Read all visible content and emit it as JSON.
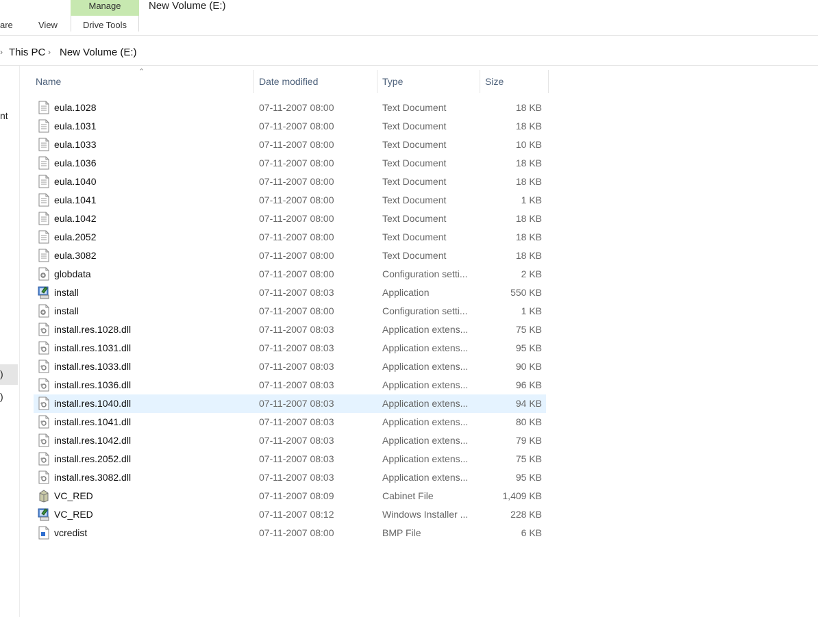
{
  "ribbon": {
    "tab_share_fragment": "are",
    "tab_view": "View",
    "context_group": "Manage",
    "context_tab": "Drive Tools",
    "window_title": "New Volume (E:)"
  },
  "address": {
    "crumbs": [
      "This PC",
      "New Volume (E:)"
    ]
  },
  "nav": {
    "fragments": [
      "nt",
      ")",
      ")"
    ]
  },
  "columns": {
    "name": "Name",
    "date": "Date modified",
    "type": "Type",
    "size": "Size"
  },
  "files": [
    {
      "name": "eula.1028",
      "date": "07-11-2007 08:00",
      "type": "Text Document",
      "size": "18 KB",
      "icon": "text-document-icon"
    },
    {
      "name": "eula.1031",
      "date": "07-11-2007 08:00",
      "type": "Text Document",
      "size": "18 KB",
      "icon": "text-document-icon"
    },
    {
      "name": "eula.1033",
      "date": "07-11-2007 08:00",
      "type": "Text Document",
      "size": "10 KB",
      "icon": "text-document-icon"
    },
    {
      "name": "eula.1036",
      "date": "07-11-2007 08:00",
      "type": "Text Document",
      "size": "18 KB",
      "icon": "text-document-icon"
    },
    {
      "name": "eula.1040",
      "date": "07-11-2007 08:00",
      "type": "Text Document",
      "size": "18 KB",
      "icon": "text-document-icon"
    },
    {
      "name": "eula.1041",
      "date": "07-11-2007 08:00",
      "type": "Text Document",
      "size": "1 KB",
      "icon": "text-document-icon"
    },
    {
      "name": "eula.1042",
      "date": "07-11-2007 08:00",
      "type": "Text Document",
      "size": "18 KB",
      "icon": "text-document-icon"
    },
    {
      "name": "eula.2052",
      "date": "07-11-2007 08:00",
      "type": "Text Document",
      "size": "18 KB",
      "icon": "text-document-icon"
    },
    {
      "name": "eula.3082",
      "date": "07-11-2007 08:00",
      "type": "Text Document",
      "size": "18 KB",
      "icon": "text-document-icon"
    },
    {
      "name": "globdata",
      "date": "07-11-2007 08:00",
      "type": "Configuration setti...",
      "size": "2 KB",
      "icon": "config-settings-icon"
    },
    {
      "name": "install",
      "date": "07-11-2007 08:03",
      "type": "Application",
      "size": "550 KB",
      "icon": "installer-application-icon"
    },
    {
      "name": "install",
      "date": "07-11-2007 08:00",
      "type": "Configuration setti...",
      "size": "1 KB",
      "icon": "config-settings-icon"
    },
    {
      "name": "install.res.1028.dll",
      "date": "07-11-2007 08:03",
      "type": "Application extens...",
      "size": "75 KB",
      "icon": "dll-file-icon"
    },
    {
      "name": "install.res.1031.dll",
      "date": "07-11-2007 08:03",
      "type": "Application extens...",
      "size": "95 KB",
      "icon": "dll-file-icon"
    },
    {
      "name": "install.res.1033.dll",
      "date": "07-11-2007 08:03",
      "type": "Application extens...",
      "size": "90 KB",
      "icon": "dll-file-icon"
    },
    {
      "name": "install.res.1036.dll",
      "date": "07-11-2007 08:03",
      "type": "Application extens...",
      "size": "96 KB",
      "icon": "dll-file-icon"
    },
    {
      "name": "install.res.1040.dll",
      "date": "07-11-2007 08:03",
      "type": "Application extens...",
      "size": "94 KB",
      "icon": "dll-file-icon",
      "selected": true
    },
    {
      "name": "install.res.1041.dll",
      "date": "07-11-2007 08:03",
      "type": "Application extens...",
      "size": "80 KB",
      "icon": "dll-file-icon"
    },
    {
      "name": "install.res.1042.dll",
      "date": "07-11-2007 08:03",
      "type": "Application extens...",
      "size": "79 KB",
      "icon": "dll-file-icon"
    },
    {
      "name": "install.res.2052.dll",
      "date": "07-11-2007 08:03",
      "type": "Application extens...",
      "size": "75 KB",
      "icon": "dll-file-icon"
    },
    {
      "name": "install.res.3082.dll",
      "date": "07-11-2007 08:03",
      "type": "Application extens...",
      "size": "95 KB",
      "icon": "dll-file-icon"
    },
    {
      "name": "VC_RED",
      "date": "07-11-2007 08:09",
      "type": "Cabinet File",
      "size": "1,409 KB",
      "icon": "cabinet-file-icon"
    },
    {
      "name": "VC_RED",
      "date": "07-11-2007 08:12",
      "type": "Windows Installer ...",
      "size": "228 KB",
      "icon": "windows-installer-icon"
    },
    {
      "name": "vcredist",
      "date": "07-11-2007 08:00",
      "type": "BMP File",
      "size": "6 KB",
      "icon": "bmp-image-icon"
    }
  ],
  "colors": {
    "manage_tab_bg": "#c7e8b0",
    "selected_row_bg": "#e5f3ff",
    "header_text": "#4c607a"
  }
}
